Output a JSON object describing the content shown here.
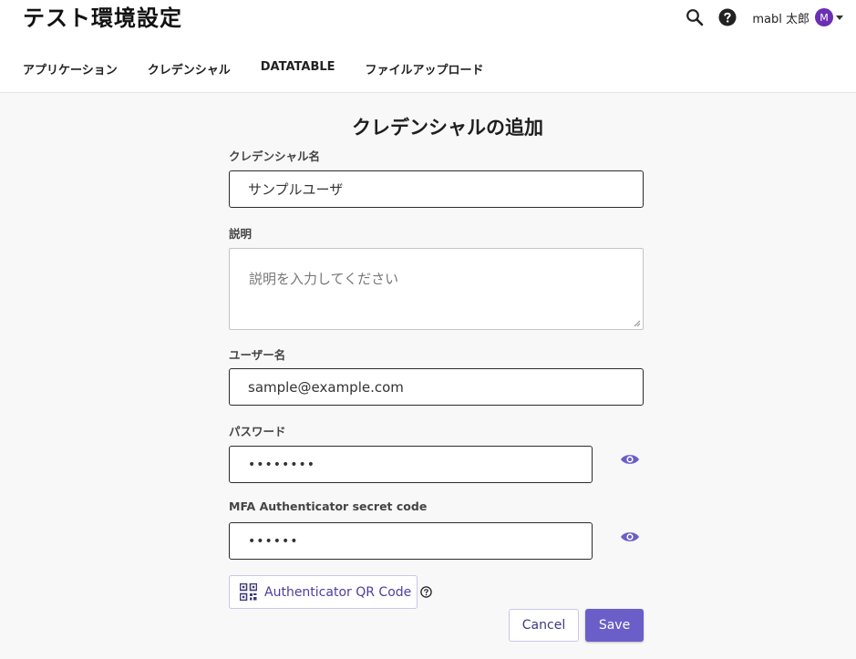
{
  "header": {
    "title": "テスト環境設定",
    "user_name": "mabl 太郎",
    "avatar_initial": "M",
    "icons": [
      "search-icon",
      "help-icon",
      "chevron-down-icon"
    ]
  },
  "nav": {
    "tabs": [
      {
        "label": "アプリケーション"
      },
      {
        "label": "クレデンシャル"
      },
      {
        "label": "DATATABLE"
      },
      {
        "label": "ファイルアップロード"
      }
    ]
  },
  "form": {
    "title": "クレデンシャルの追加",
    "name_label": "クレデンシャル名",
    "name_value": "サンプルユーザ",
    "description_label": "説明",
    "description_placeholder": "説明を入力してください",
    "username_label": "ユーザー名",
    "username_value": "sample@example.com",
    "password_label": "パスワード",
    "password_value": "••••••••",
    "mfa_label": "MFA Authenticator secret code",
    "mfa_value": "••••••",
    "qr_button_label": "Authenticator QR Code",
    "cancel_label": "Cancel",
    "save_label": "Save"
  },
  "colors": {
    "accent": "#6a5fc9",
    "avatar": "#6b2fb3",
    "content_bg": "#f8f8f8"
  }
}
